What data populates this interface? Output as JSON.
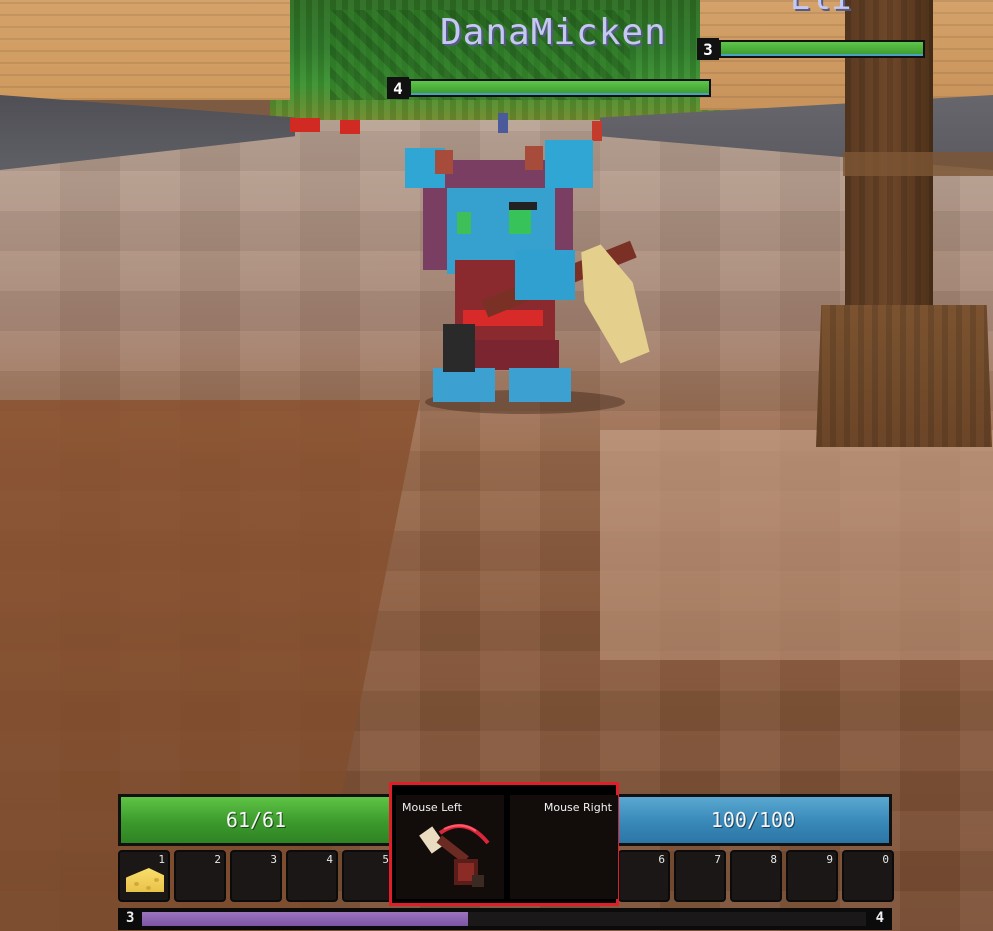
{
  "nameplates": {
    "main": {
      "name": "DanaMicken",
      "level": "3",
      "health_fraction": 1.0
    },
    "secondary": {
      "level": "4",
      "health_fraction": 1.0
    },
    "top_right": {
      "name": "Eli"
    }
  },
  "hud": {
    "health": {
      "text": "61/61",
      "current": 61,
      "max": 61,
      "color": "#3f9e2f"
    },
    "energy": {
      "text": "100/100",
      "current": 100,
      "max": 100,
      "color": "#3888b8"
    },
    "abilities": {
      "left": {
        "label": "Mouse Left",
        "icon": "guitar-icon"
      },
      "right": {
        "label": "Mouse Right",
        "icon": ""
      }
    },
    "hotbar_left": [
      {
        "key": "1",
        "item": "cheese-icon"
      },
      {
        "key": "2",
        "item": ""
      },
      {
        "key": "3",
        "item": ""
      },
      {
        "key": "4",
        "item": ""
      },
      {
        "key": "5",
        "item": ""
      }
    ],
    "hotbar_right": [
      {
        "key": "6",
        "item": ""
      },
      {
        "key": "7",
        "item": ""
      },
      {
        "key": "8",
        "item": ""
      },
      {
        "key": "9",
        "item": ""
      },
      {
        "key": "0",
        "item": ""
      }
    ],
    "experience": {
      "current_level": "3",
      "next_level": "4",
      "progress_fraction": 0.45,
      "color": "#8a62b0"
    }
  },
  "highlight": {
    "target": "ability-box",
    "color": "#e01e2a"
  }
}
